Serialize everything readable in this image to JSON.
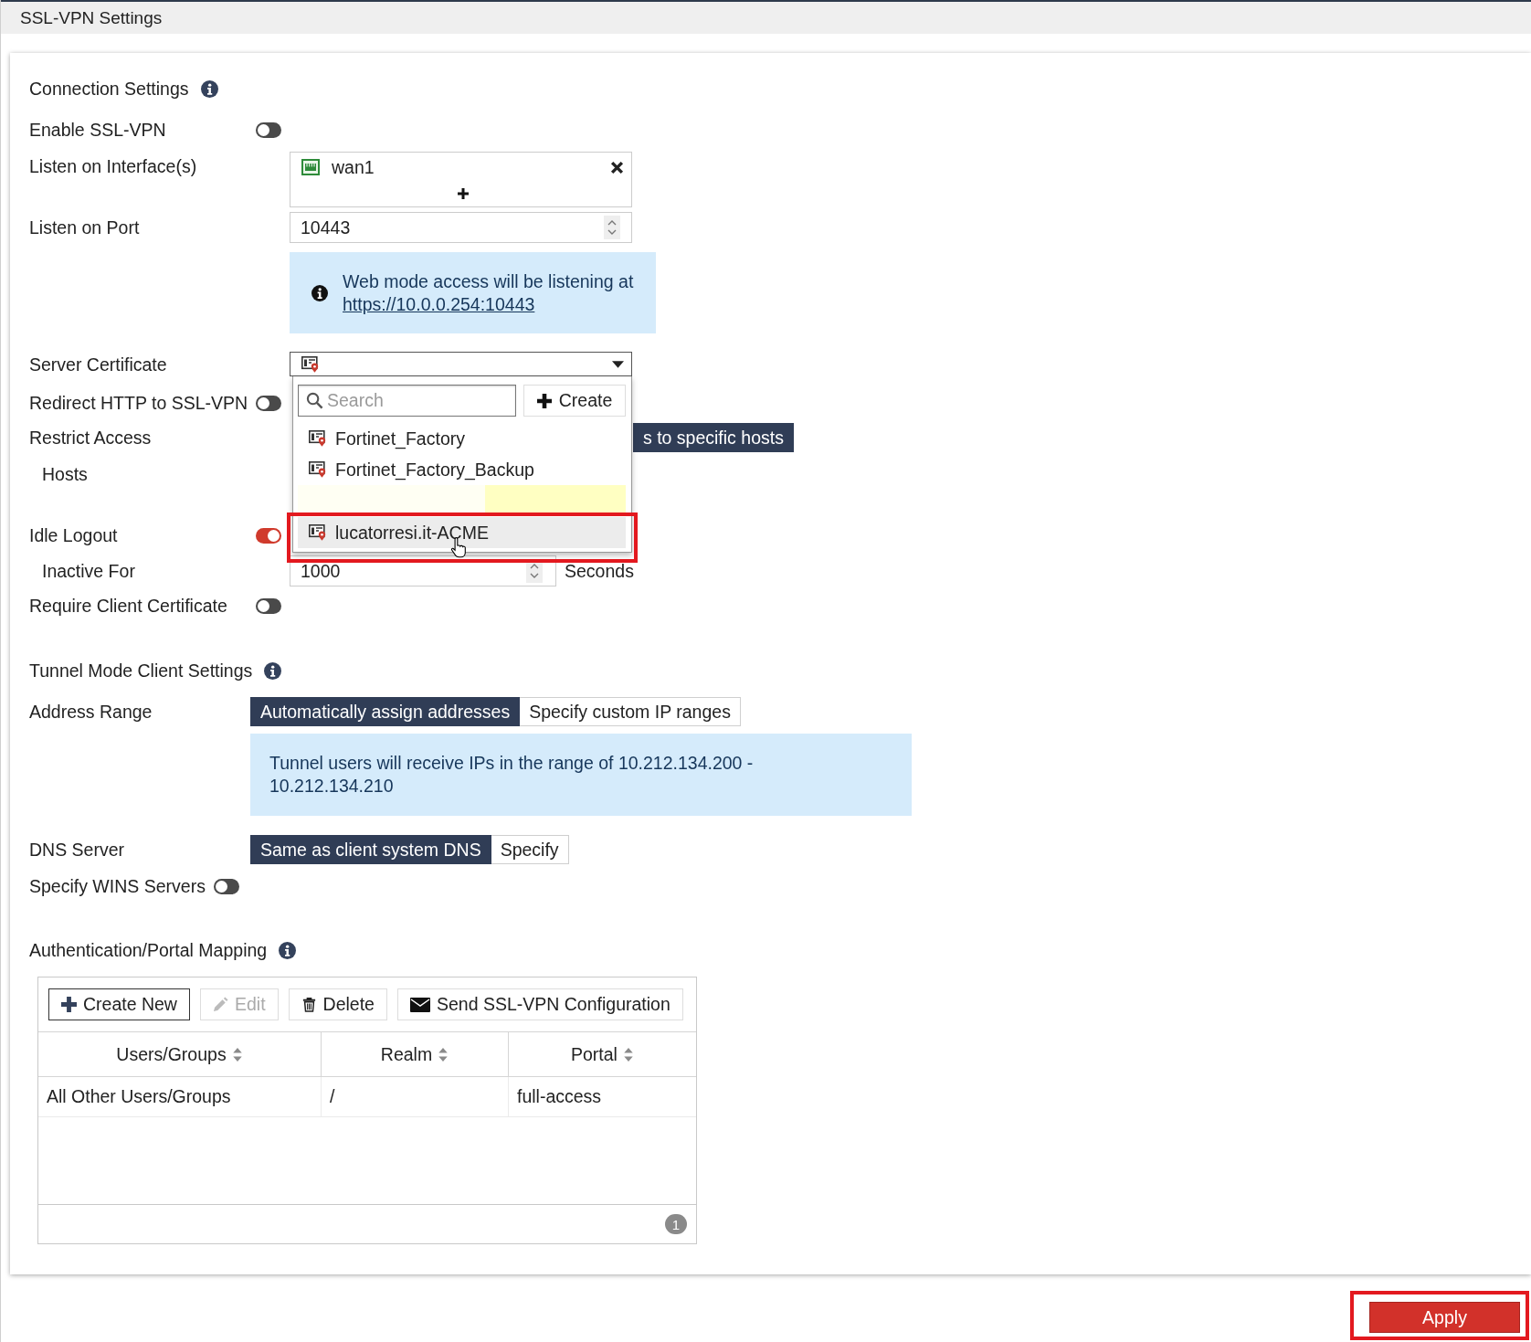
{
  "title": "SSL-VPN Settings",
  "connection_settings": {
    "heading": "Connection Settings",
    "enable_ssl_vpn": {
      "label": "Enable SSL-VPN",
      "on": false
    },
    "listen_on_interfaces": {
      "label": "Listen on Interface(s)",
      "interfaces": [
        {
          "name": "wan1"
        }
      ]
    },
    "listen_on_port": {
      "label": "Listen on Port",
      "value": "10443"
    },
    "web_mode_note": {
      "text": "Web mode access will be listening at",
      "link": "https://10.0.0.254:10443"
    },
    "server_certificate": {
      "label": "Server Certificate",
      "expanded": true,
      "search": {
        "placeholder": "Search"
      },
      "create_button": "Create",
      "options": [
        {
          "kind": "certificate",
          "label": "Fortinet_Factory",
          "selected": false,
          "annotated": false
        },
        {
          "kind": "certificate",
          "label": "Fortinet_Factory_Backup",
          "selected": false,
          "annotated": false
        },
        {
          "kind": "blank",
          "highlighted": true
        },
        {
          "kind": "certificate",
          "label": "lucatorresi.it-ACME",
          "selected": true,
          "annotated": true
        }
      ]
    },
    "redirect_http_to_ssl_vpn": {
      "label": "Redirect HTTP to SSL-VPN",
      "on": false
    },
    "restrict_access": {
      "label": "Restrict Access",
      "options": [
        {
          "label": "s to specific hosts",
          "selected": true
        }
      ]
    },
    "hosts": {
      "label": "Hosts"
    },
    "idle_logout": {
      "label": "Idle Logout",
      "on": true
    },
    "inactive_for": {
      "label": "Inactive For",
      "value": "1000",
      "unit": "Seconds"
    },
    "require_client_certificate": {
      "label": "Require Client Certificate",
      "on": false
    }
  },
  "tunnel_mode_client_settings": {
    "heading": "Tunnel Mode Client Settings",
    "address_range": {
      "label": "Address Range",
      "options": [
        {
          "label": "Automatically assign addresses",
          "selected": true
        },
        {
          "label": "Specify custom IP ranges",
          "selected": false
        }
      ],
      "note": "Tunnel users will receive IPs in the range of 10.212.134.200 - 10.212.134.210"
    },
    "dns_server": {
      "label": "DNS Server",
      "options": [
        {
          "label": "Same as client system DNS",
          "selected": true
        },
        {
          "label": "Specify",
          "selected": false
        }
      ]
    },
    "specify_wins_servers": {
      "label": "Specify WINS Servers",
      "on": false
    }
  },
  "authentication_portal_mapping": {
    "heading": "Authentication/Portal Mapping",
    "toolbar": [
      {
        "kind": "create",
        "label": "Create New",
        "focused": true,
        "disabled": false
      },
      {
        "kind": "edit",
        "label": "Edit",
        "focused": false,
        "disabled": true
      },
      {
        "kind": "delete",
        "label": "Delete",
        "focused": false,
        "disabled": false
      },
      {
        "kind": "send",
        "label": "Send SSL-VPN Configuration",
        "focused": false,
        "disabled": false
      }
    ],
    "columns": [
      "Users/Groups",
      "Realm",
      "Portal"
    ],
    "rows": [
      [
        "All Other Users/Groups",
        "/",
        "full-access"
      ]
    ],
    "count": "1"
  },
  "apply_button": {
    "label": "Apply",
    "annotated": true
  }
}
